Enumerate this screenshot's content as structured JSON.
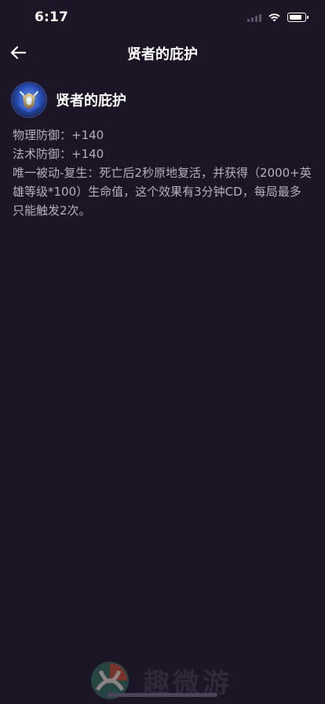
{
  "status_bar": {
    "time": "6:17",
    "battery_level": 0.85
  },
  "nav": {
    "title": "贤者的庇护",
    "back_icon": "arrow-left-icon"
  },
  "item": {
    "name": "贤者的庇护",
    "icon": "item-icon",
    "description_lines": [
      "物理防御：+140",
      "法术防御：+140",
      "唯一被动-复生：死亡后2秒原地复活，并获得（2000+英雄等级*100）生命值，这个效果有3分钟CD，每局最多只能触发2次。"
    ]
  },
  "watermark": {
    "text": "趣微游"
  },
  "colors": {
    "background": "#1b1526",
    "text_primary": "#ffffff",
    "text_secondary": "#b4b0be"
  }
}
